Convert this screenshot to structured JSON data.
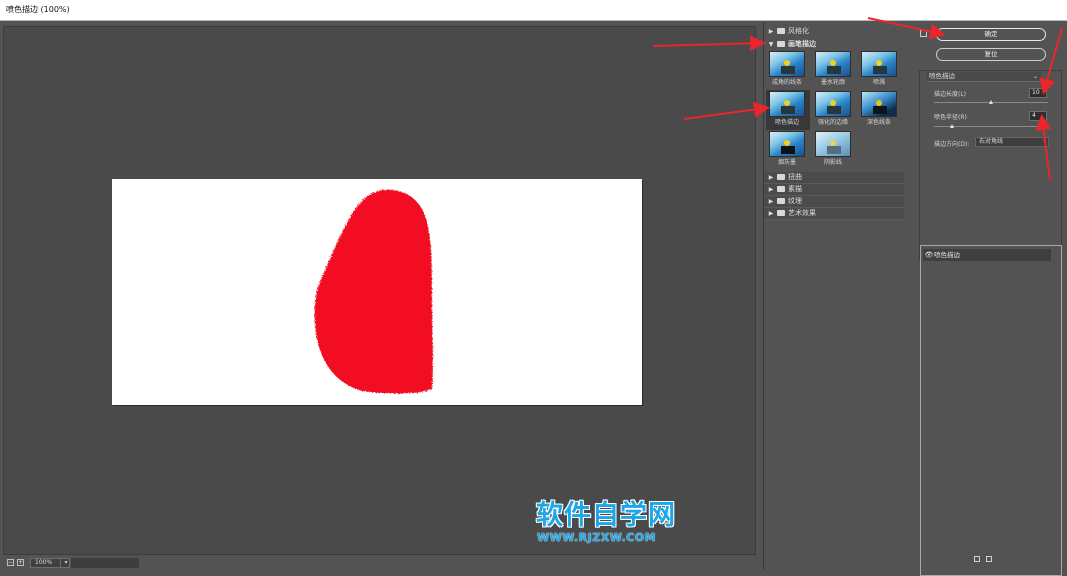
{
  "window": {
    "title": "喷色描边 (100%)"
  },
  "preview": {
    "zoom": "100%"
  },
  "watermark": {
    "brand": "软件自学网",
    "url": "WWW.RJZXW.COM"
  },
  "gallery": {
    "folders_top": [
      {
        "label": "风格化",
        "expanded": false
      },
      {
        "label": "画笔描边",
        "expanded": true
      }
    ],
    "filters": [
      {
        "label": "成角的线条"
      },
      {
        "label": "墨水轮廓"
      },
      {
        "label": "喷溅"
      },
      {
        "label": "喷色描边",
        "selected": true
      },
      {
        "label": "强化的边缘"
      },
      {
        "label": "深色线条"
      },
      {
        "label": "烟灰墨"
      },
      {
        "label": "阴影线"
      }
    ],
    "folders_bottom": [
      {
        "label": "扭曲"
      },
      {
        "label": "素描"
      },
      {
        "label": "纹理"
      },
      {
        "label": "艺术效果"
      }
    ]
  },
  "buttons": {
    "ok": "确定",
    "reset": "复位"
  },
  "settings": {
    "filter_select": "喷色描边",
    "stroke_length": {
      "label": "描边长度(L)",
      "value": "10",
      "max": 20
    },
    "spray_radius": {
      "label": "喷色半径(R)",
      "value": "4",
      "max": 25
    },
    "stroke_direction": {
      "label": "描边方向(D):",
      "value": "右对角线"
    }
  },
  "layers": {
    "items": [
      {
        "label": "喷色描边"
      }
    ]
  }
}
